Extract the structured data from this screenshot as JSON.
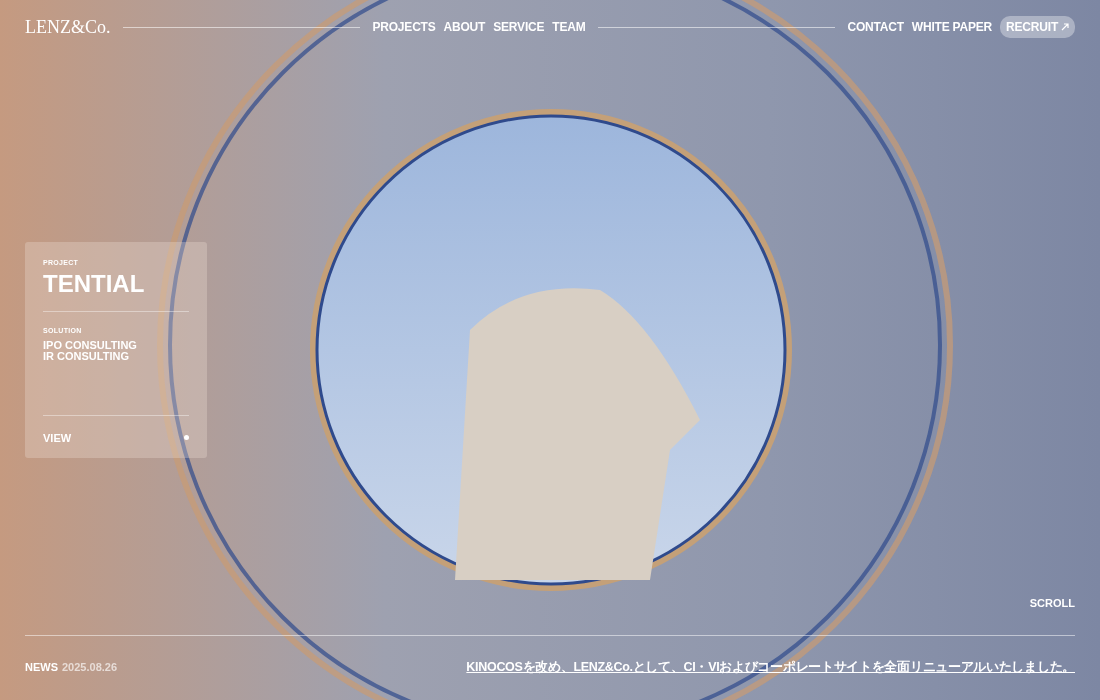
{
  "logo": "LENZ&Co.",
  "nav": [
    "PROJECTS",
    "ABOUT",
    "SERVICE",
    "TEAM"
  ],
  "nav_right": [
    {
      "label": "CONTACT",
      "kind": "link"
    },
    {
      "label": "WHITE PAPER",
      "kind": "link"
    },
    {
      "label": "RECRUIT",
      "kind": "pill"
    }
  ],
  "project_card": {
    "label": "PROJECT",
    "title": "TENTIAL",
    "solution_label": "SOLUTION",
    "solutions": [
      "IPO CONSULTING",
      "IR CONSULTING"
    ],
    "action": "VIEW"
  },
  "scroll": "SCROLL",
  "news": {
    "label": "NEWS",
    "date": "2025.08.26",
    "headline": "KINOCOSを改め、LENZ&Co.として、CI・VIおよびコーポレートサイトを全面リニューアルいたしました。"
  }
}
